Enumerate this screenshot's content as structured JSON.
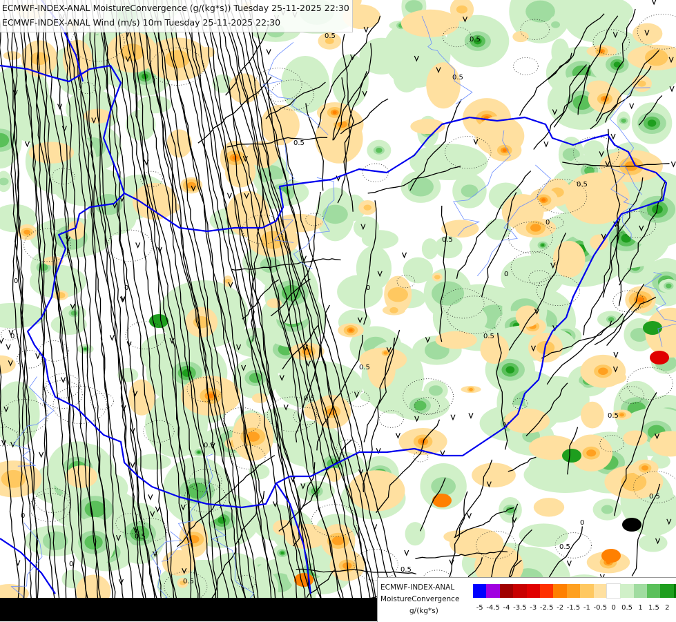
{
  "title": {
    "line1": "ECMWF-INDEX-ANAL MoistureConvergence (g/(kg*s)) Tuesday 25-11-2025 22:30",
    "line2": "ECMWF-INDEX-ANAL Wind (m/s) 10m Tuesday 25-11-2025 22:30"
  },
  "legend": {
    "model": "ECMWF-INDEX-ANAL",
    "variable": "MoistureConvergence",
    "unit": "g/(kg*s)",
    "tick_labels": [
      "-5",
      "-4.5",
      "-4",
      "-3.5",
      "-3",
      "-2.5",
      "-2",
      "-1.5",
      "-1",
      "-0.5",
      "0",
      "0.5",
      "1",
      "1.5",
      "2"
    ],
    "colors": [
      "#0000ff",
      "#a000e0",
      "#a00000",
      "#c80000",
      "#e00000",
      "#ff3000",
      "#ff8000",
      "#ffa020",
      "#ffc860",
      "#ffe0a0",
      "#ffffff",
      "#d0f0c8",
      "#a0dca0",
      "#5ac05a",
      "#1e9e1e",
      "#007800"
    ]
  },
  "contour_labels": [
    "0.5",
    "0.5",
    "0.5",
    "0.5",
    "0.5",
    "0.5",
    "0.5",
    "0.5",
    "0.5",
    "0.5",
    "0.5",
    "0.5",
    "0.5",
    "0.5",
    "0.5",
    "0.5",
    "0",
    "0",
    "0",
    "0",
    "0",
    "0",
    "0",
    "0",
    "0"
  ],
  "colors": {
    "border": "#0000ee",
    "streamline": "#000000",
    "river": "#6a8cff"
  }
}
